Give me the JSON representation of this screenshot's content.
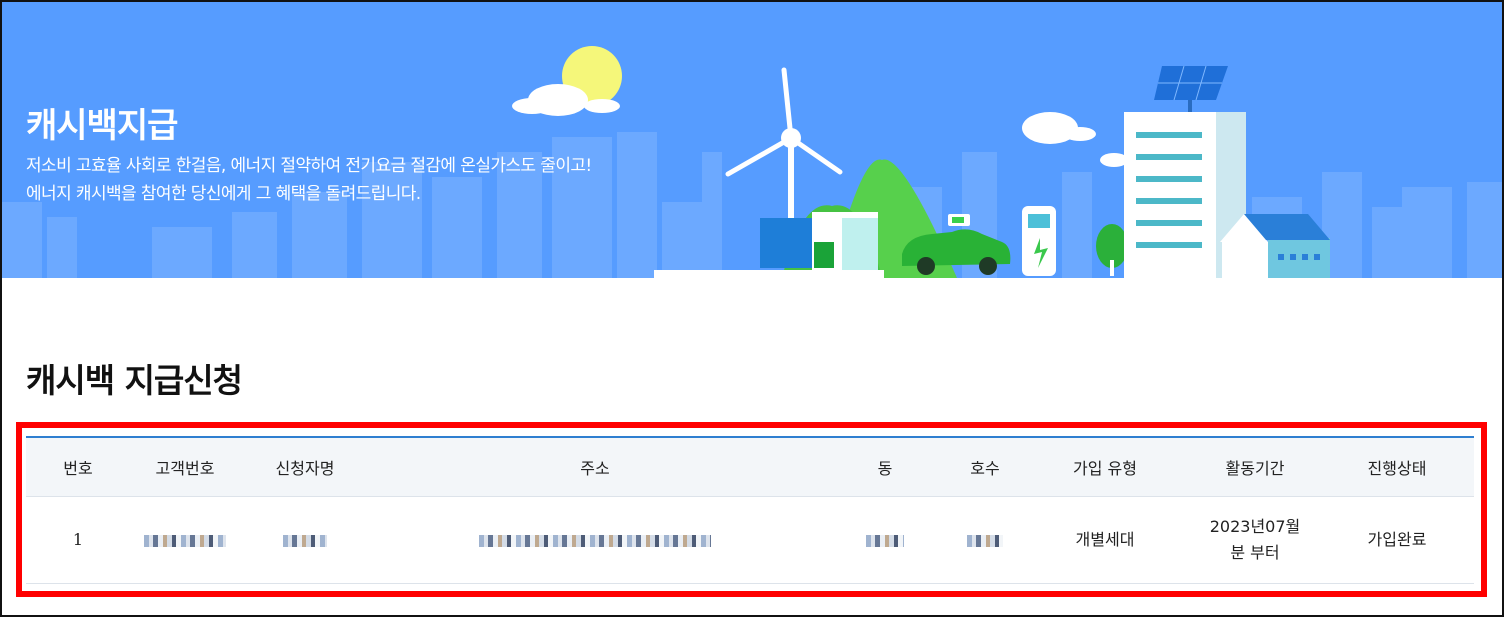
{
  "banner": {
    "title": "캐시백지급",
    "desc_line1": "저소비 고효율 사회로 한걸음, 에너지 절약하여 전기요금 절감에 온실가스도 줄이고!",
    "desc_line2": "에너지 캐시백을 참여한 당신에게 그 혜택을 돌려드립니다.",
    "accent_color": "#569cff"
  },
  "section": {
    "title": "캐시백 지급신청"
  },
  "table": {
    "headers": [
      "번호",
      "고객번호",
      "신청자명",
      "주소",
      "동",
      "호수",
      "가입 유형",
      "활동기간",
      "진행상태"
    ],
    "rows": [
      {
        "number": "1",
        "customer_no": "",
        "applicant": "",
        "address": "",
        "dong": "",
        "ho": "",
        "join_type": "개별세대",
        "period": "2023년07월분 부터",
        "status": "가입완료"
      }
    ],
    "header_border_color": "#2f7fd0"
  },
  "highlight_color": "#ff0000"
}
